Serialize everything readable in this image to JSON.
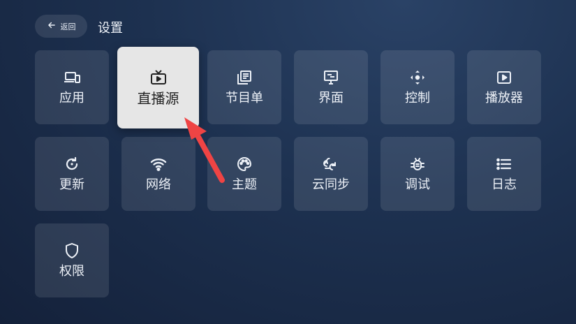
{
  "header": {
    "back_label": "返回",
    "title": "设置"
  },
  "tiles": [
    {
      "label": "应用",
      "icon": "devices-icon"
    },
    {
      "label": "直播源",
      "icon": "tv-play-icon"
    },
    {
      "label": "节目单",
      "icon": "library-icon"
    },
    {
      "label": "界面",
      "icon": "monitor-icon"
    },
    {
      "label": "控制",
      "icon": "dpad-icon"
    },
    {
      "label": "播放器",
      "icon": "play-box-icon"
    },
    {
      "label": "更新",
      "icon": "refresh-icon"
    },
    {
      "label": "网络",
      "icon": "wifi-icon"
    },
    {
      "label": "主题",
      "icon": "palette-icon"
    },
    {
      "label": "云同步",
      "icon": "cloud-sync-icon"
    },
    {
      "label": "调试",
      "icon": "bug-icon"
    },
    {
      "label": "日志",
      "icon": "list-icon"
    },
    {
      "label": "权限",
      "icon": "shield-icon"
    }
  ],
  "focused_tile": "直播源",
  "colors": {
    "background": "#1d3150",
    "tile": "#34445c",
    "tile_focused": "#e6e6e6",
    "annotation_arrow": "#ef4444"
  }
}
